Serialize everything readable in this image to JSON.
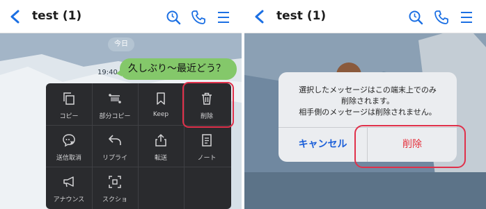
{
  "left": {
    "header": {
      "title": "test (1)"
    },
    "chat": {
      "date_label": "今日",
      "message": {
        "text": "久しぶり〜最近どう？",
        "time": "19:40"
      }
    },
    "menu": {
      "items": [
        {
          "label": "コピー",
          "icon": "copy-icon"
        },
        {
          "label": "部分コピー",
          "icon": "partial-copy-icon"
        },
        {
          "label": "Keep",
          "icon": "bookmark-icon"
        },
        {
          "label": "削除",
          "icon": "trash-icon"
        },
        {
          "label": "送信取消",
          "icon": "unsend-icon"
        },
        {
          "label": "リプライ",
          "icon": "reply-icon"
        },
        {
          "label": "転送",
          "icon": "share-icon"
        },
        {
          "label": "ノート",
          "icon": "note-icon"
        },
        {
          "label": "アナウンス",
          "icon": "megaphone-icon"
        },
        {
          "label": "スクショ",
          "icon": "screenshot-icon"
        }
      ]
    }
  },
  "right": {
    "header": {
      "title": "test (1)"
    },
    "dialog": {
      "message_line1": "選択したメッセージはこの端末上でのみ",
      "message_line2": "削除されます。",
      "message_line3": "相手側のメッセージは削除されません。",
      "cancel_label": "キャンセル",
      "delete_label": "削除"
    }
  },
  "colors": {
    "accent": "#1b5fd9",
    "bubble_green": "#84c86a",
    "highlight_red": "#e0304a",
    "menu_bg": "#2a2b2e"
  }
}
